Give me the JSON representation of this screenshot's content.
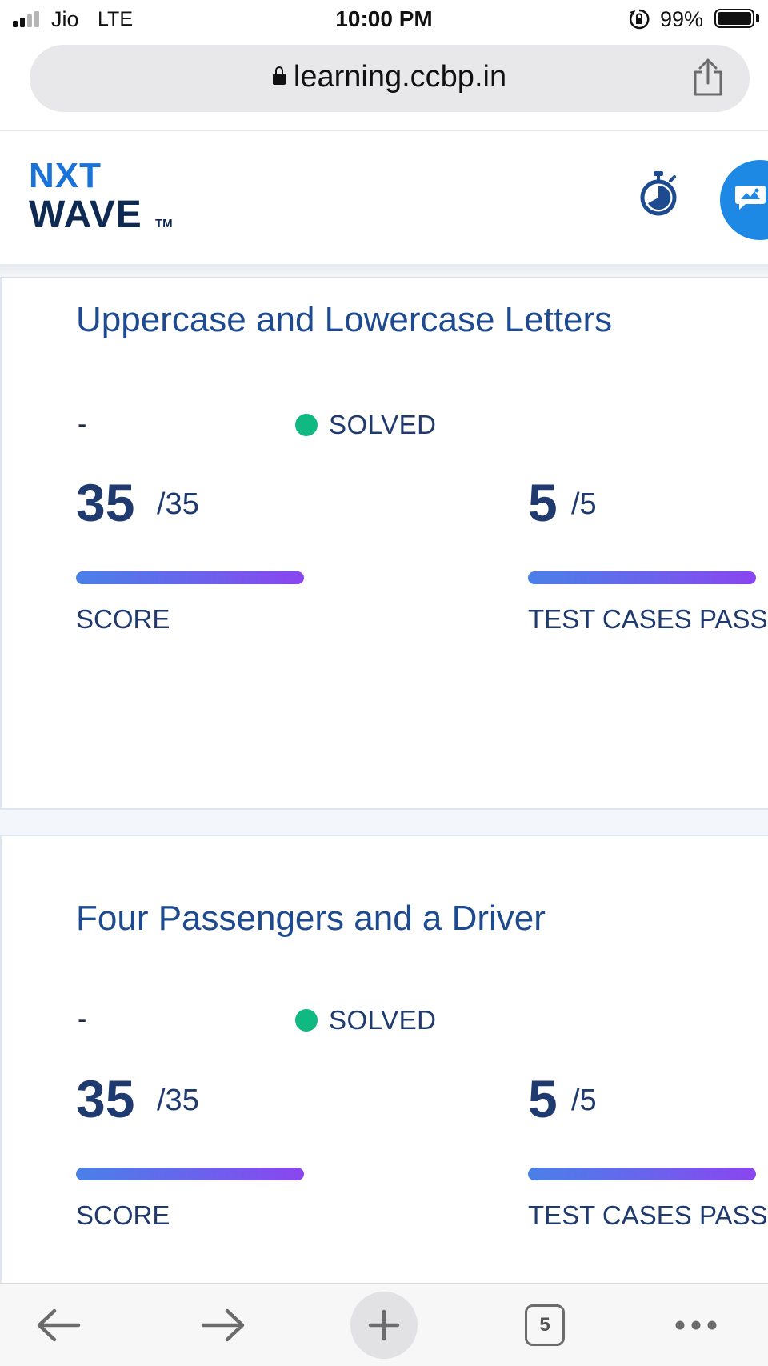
{
  "status_bar": {
    "carrier": "Jio",
    "network": "LTE",
    "time": "10:00 PM",
    "battery": "99%"
  },
  "browser": {
    "url": "learning.ccbp.in",
    "tab_count": "5"
  },
  "header": {
    "logo_line1": "NXT",
    "logo_line2": "WAVE",
    "logo_tm": "TM"
  },
  "problems": [
    {
      "title": "Uppercase and Lowercase Letters",
      "dash": "-",
      "status": "SOLVED",
      "score": "35",
      "score_max": "/35",
      "score_label": "SCORE",
      "score_fraction": 1.0,
      "test_cases": "5",
      "test_cases_max": "/5",
      "test_cases_label": "TEST CASES PASS",
      "test_cases_fraction": 1.0
    },
    {
      "title": "Four Passengers and a Driver",
      "dash": "-",
      "status": "SOLVED",
      "score": "35",
      "score_max": "/35",
      "score_label": "SCORE",
      "score_fraction": 1.0,
      "test_cases": "5",
      "test_cases_max": "/5",
      "test_cases_label": "TEST CASES PASS",
      "test_cases_fraction": 1.0
    }
  ],
  "colors": {
    "brand_blue": "#1e4b8f",
    "solved_green": "#10b981",
    "progress_start": "#4a80e8",
    "progress_end": "#8b45f0",
    "chat_button": "#1e88e5"
  },
  "icons": [
    "signal-icon",
    "lock-icon",
    "share-icon",
    "timer-icon",
    "chat-icon",
    "back-icon",
    "forward-icon",
    "plus-icon",
    "tabs-icon",
    "more-icon"
  ]
}
